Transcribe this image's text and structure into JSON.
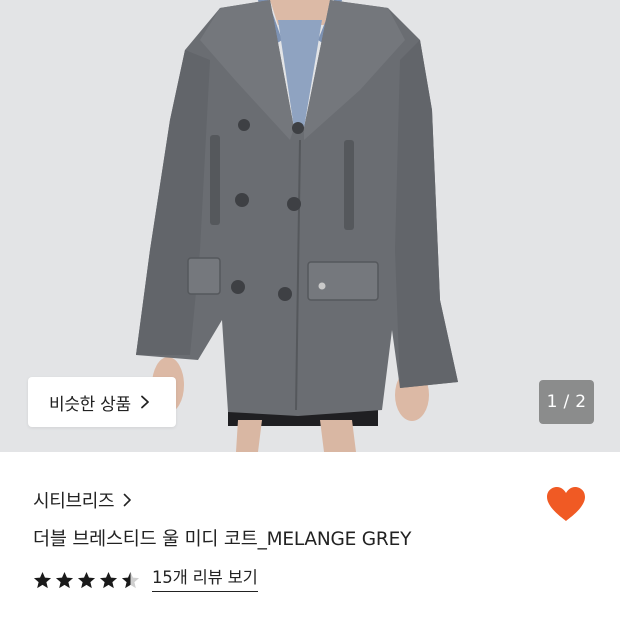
{
  "gallery": {
    "image_alt": "Grey double-breasted wool peacoat on model",
    "similar_button_label": "비슷한 상품",
    "counter": "1 / 2"
  },
  "product": {
    "brand": "시티브리즈",
    "title": "더블 브레스티드 울 미디 코트_MELANGE GREY",
    "rating": 4.5,
    "review_link": "15개 리뷰 보기"
  },
  "colors": {
    "heart": "#f05a24",
    "star": "#1a1a1a",
    "star_empty": "#cfcfcf",
    "coat": "#6a6d72",
    "background": "#e3e4e6"
  },
  "icons": {
    "similar_chevron": "chevron-right-icon",
    "brand_chevron": "chevron-right-icon",
    "wishlist": "heart-icon",
    "star": "star-icon"
  }
}
